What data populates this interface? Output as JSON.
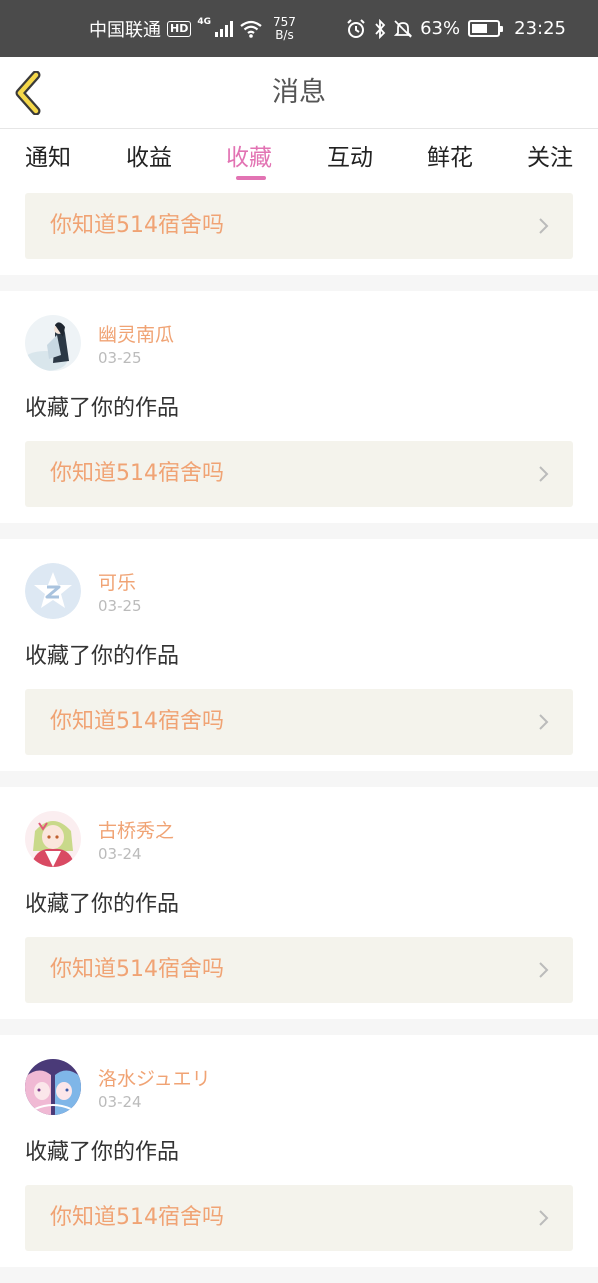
{
  "status_bar": {
    "carrier": "中国联通",
    "hd": "HD",
    "network": "4G",
    "speed_value": "757",
    "speed_unit": "B/s",
    "battery": "63%",
    "battery_level": 0.63,
    "time": "23:25"
  },
  "header": {
    "back_icon": "chevron-left-icon",
    "title": "消息"
  },
  "tabs": [
    {
      "label": "通知",
      "active": false
    },
    {
      "label": "收益",
      "active": false
    },
    {
      "label": "收藏",
      "active": true
    },
    {
      "label": "互动",
      "active": false
    },
    {
      "label": "鲜花",
      "active": false
    },
    {
      "label": "关注",
      "active": false
    }
  ],
  "colors": {
    "accent": "#e273b3",
    "username": "#f0a374",
    "work_bg": "#f4f3ec",
    "status_bar": "#4b4b4b"
  },
  "first_work": {
    "title": "你知道514宿舍吗"
  },
  "items": [
    {
      "username": "幽灵南瓜",
      "date": "03-25",
      "action": "收藏了你的作品",
      "work_title": "你知道514宿舍吗",
      "avatar": "anime-figure-avatar"
    },
    {
      "username": "可乐",
      "date": "03-25",
      "action": "收藏了你的作品",
      "work_title": "你知道514宿舍吗",
      "avatar": "default-star-avatar"
    },
    {
      "username": "古桥秀之",
      "date": "03-24",
      "action": "收藏了你的作品",
      "work_title": "你知道514宿舍吗",
      "avatar": "anime-girl-avatar"
    },
    {
      "username": "洛水ジュエリ",
      "date": "03-24",
      "action": "收藏了你的作品",
      "work_title": "你知道514宿舍吗",
      "avatar": "anime-twins-avatar"
    }
  ]
}
